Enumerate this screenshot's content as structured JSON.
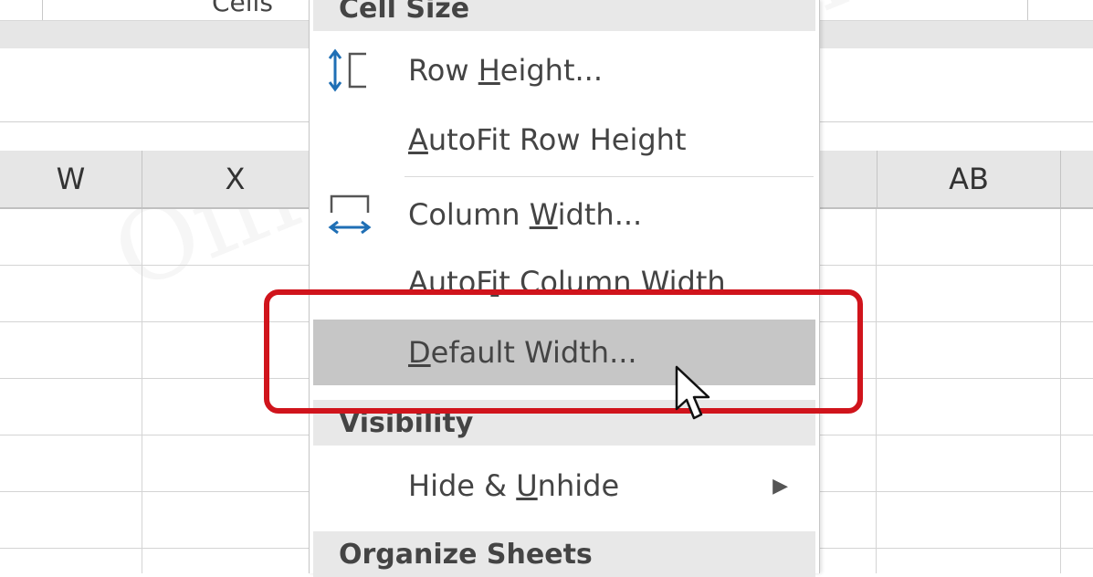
{
  "ribbon": {
    "group_label": "Cells"
  },
  "columns": [
    "W",
    "X",
    "AB"
  ],
  "menu": {
    "sections": {
      "cell_size": "Cell Size",
      "visibility": "Visibility",
      "organize": "Organize Sheets"
    },
    "items": {
      "row_height": {
        "pre": "Row ",
        "ul": "H",
        "post": "eight..."
      },
      "autofit_row": {
        "pre": "",
        "ul": "A",
        "post": "utoFit Row Height"
      },
      "column_width": {
        "pre": "Column ",
        "ul": "W",
        "post": "idth..."
      },
      "autofit_col": {
        "pre": "AutoF",
        "ul": "i",
        "post": "t Column Width"
      },
      "default_width": {
        "pre": "",
        "ul": "D",
        "post": "efault Width..."
      },
      "hide_unhide": {
        "pre": "Hide & ",
        "ul": "U",
        "post": "nhide"
      }
    },
    "submenu_arrow": "▶"
  },
  "watermark": "OfficeTuto.com",
  "colors": {
    "highlight": "#d0141c",
    "hover": "#c6c6c6",
    "section_bg": "#e8e8e8"
  },
  "icons": {
    "row_height": "row-height-icon",
    "column_width": "column-width-icon",
    "cursor": "mouse-pointer-icon"
  }
}
